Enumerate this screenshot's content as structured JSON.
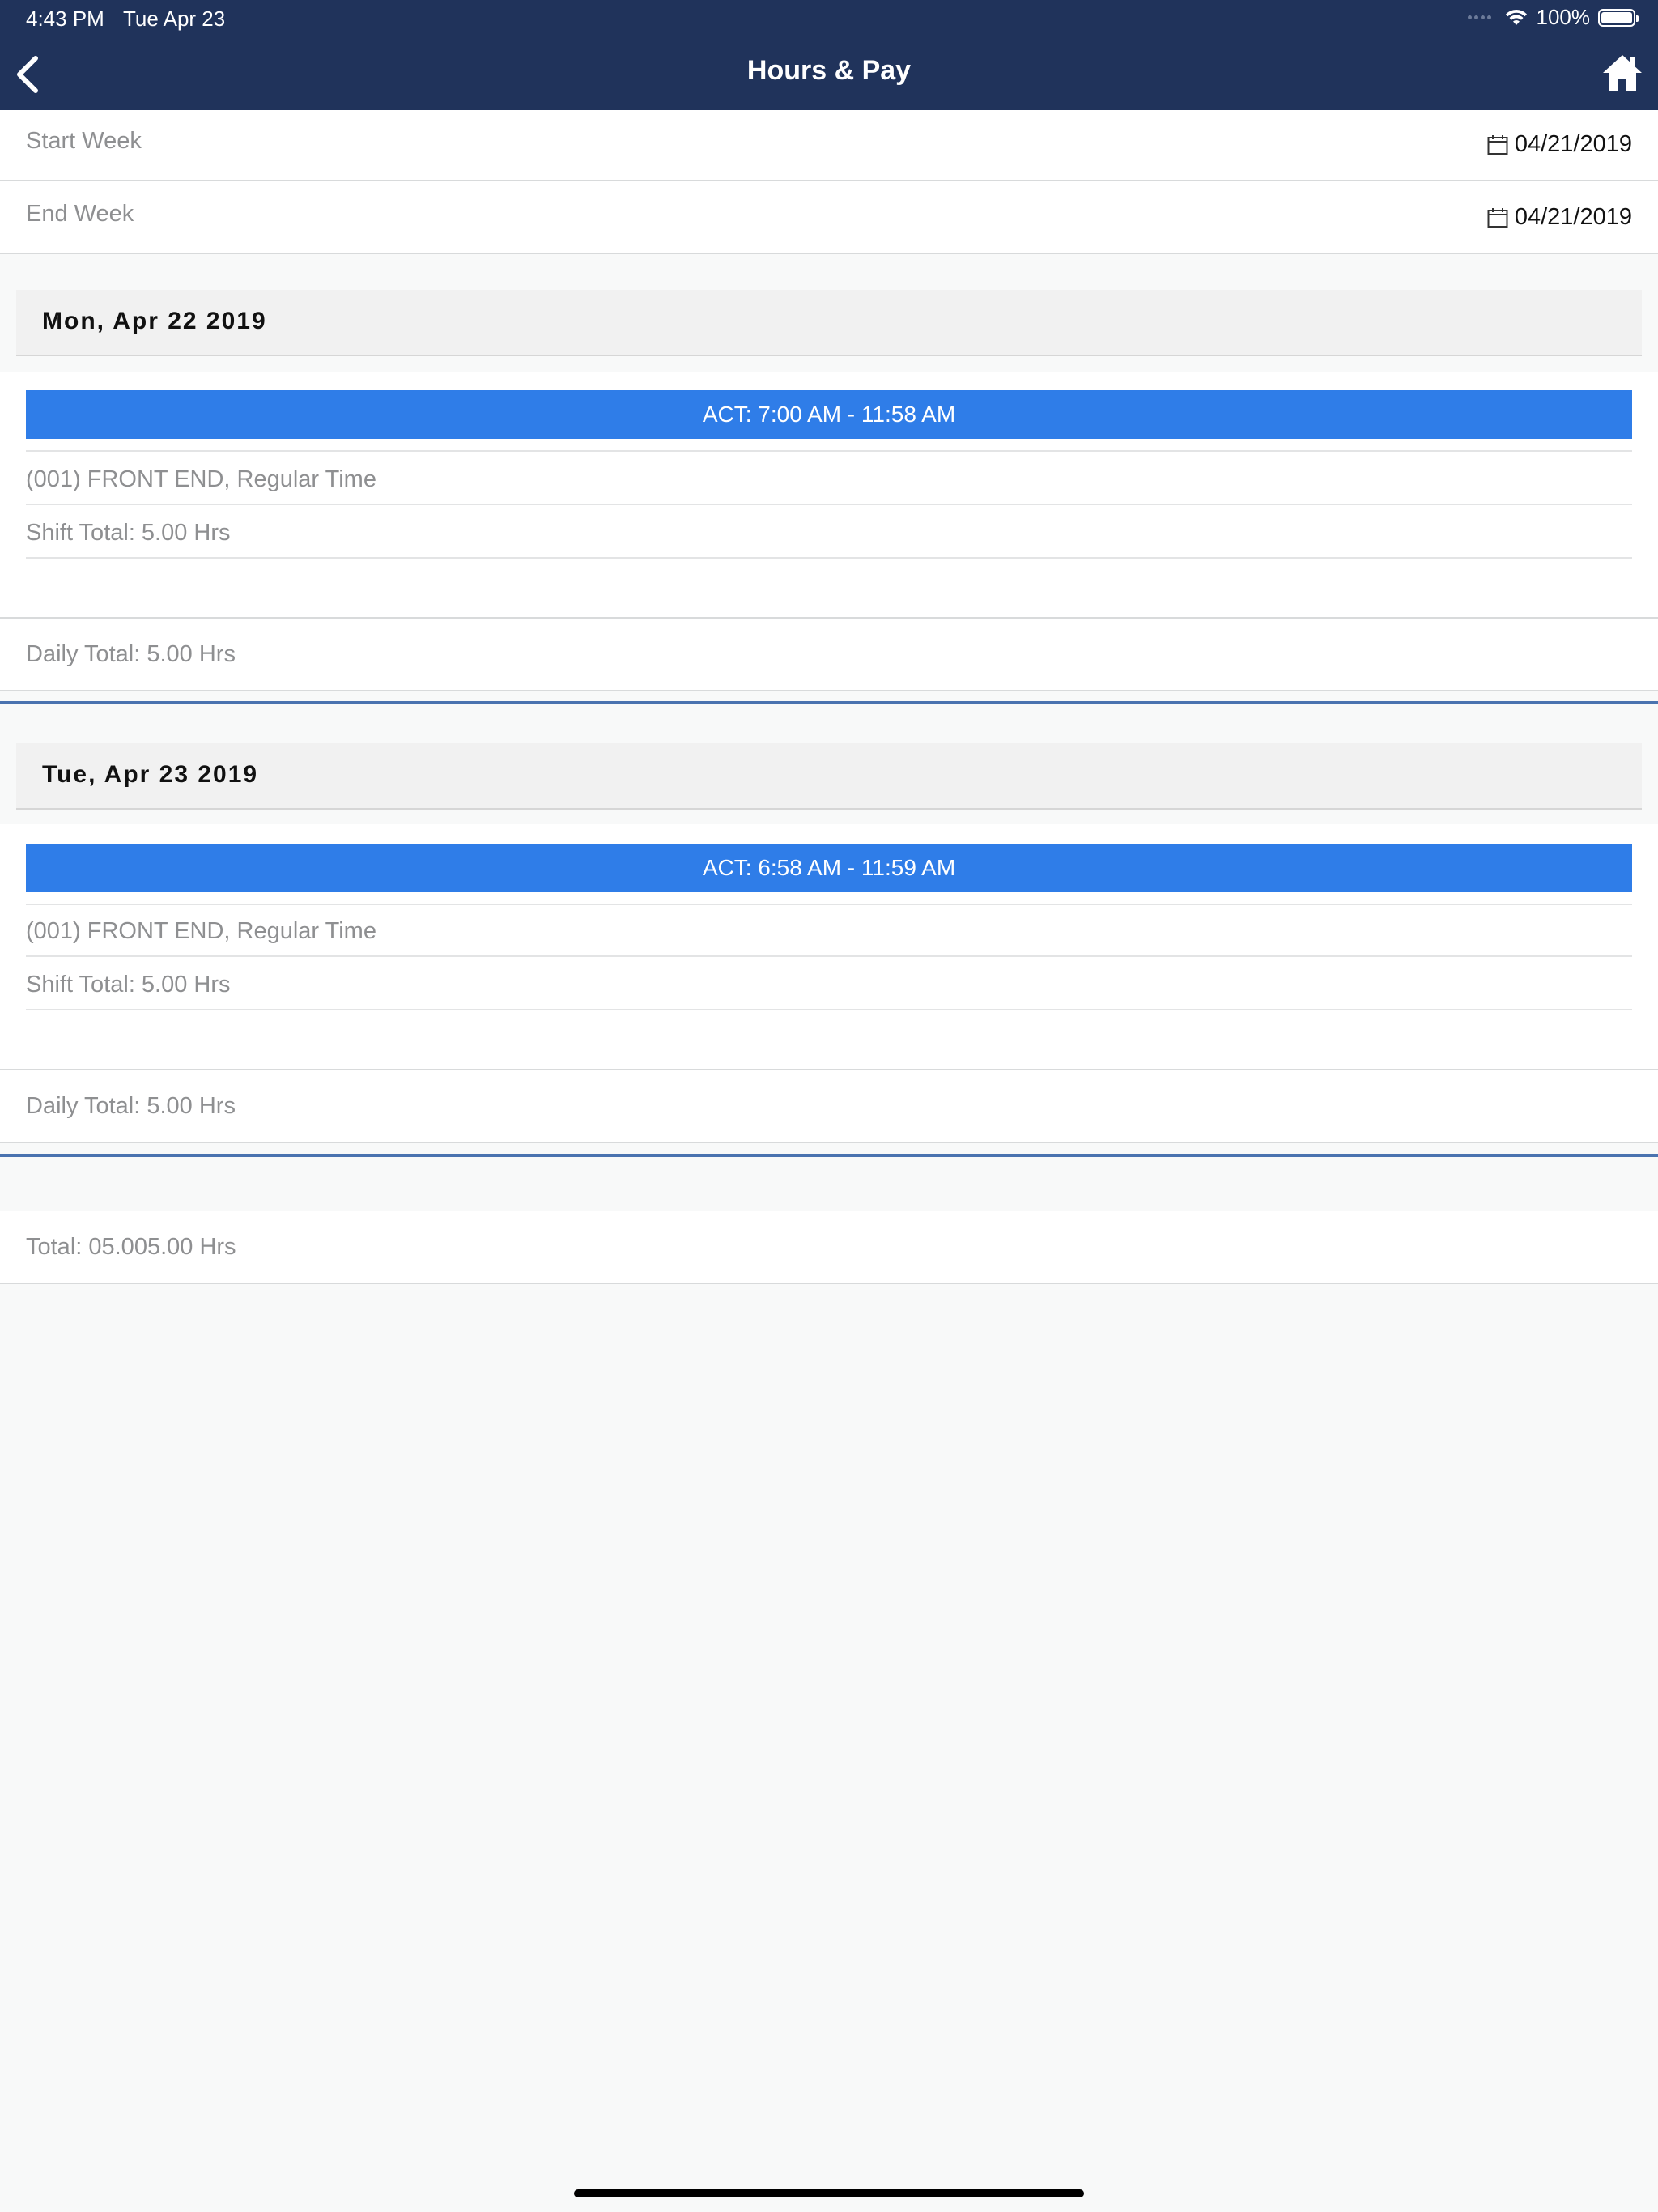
{
  "status_bar": {
    "time": "4:43 PM",
    "date": "Tue Apr 23",
    "battery": "100%"
  },
  "nav": {
    "title": "Hours & Pay",
    "back_icon": "chevron-left-icon",
    "home_icon": "home-icon"
  },
  "filters": {
    "start_label": "Start Week",
    "start_value": "04/21/2019",
    "end_label": "End Week",
    "end_value": "04/21/2019"
  },
  "days": [
    {
      "title": "Mon, Apr 22 2019",
      "act": "ACT: 7:00 AM - 11:58 AM",
      "job": "(001) FRONT END, Regular Time",
      "shift_total": "Shift Total: 5.00 Hrs",
      "daily_total": "Daily Total: 5.00 Hrs"
    },
    {
      "title": "Tue, Apr 23 2019",
      "act": "ACT: 6:58 AM - 11:59 AM",
      "job": "(001) FRONT END, Regular Time",
      "shift_total": "Shift Total: 5.00 Hrs",
      "daily_total": "Daily Total: 5.00 Hrs"
    }
  ],
  "total": "Total: 05.005.00 Hrs",
  "colors": {
    "header": "#20335b",
    "accent": "#2f7de8",
    "divider": "#4a73b0"
  }
}
